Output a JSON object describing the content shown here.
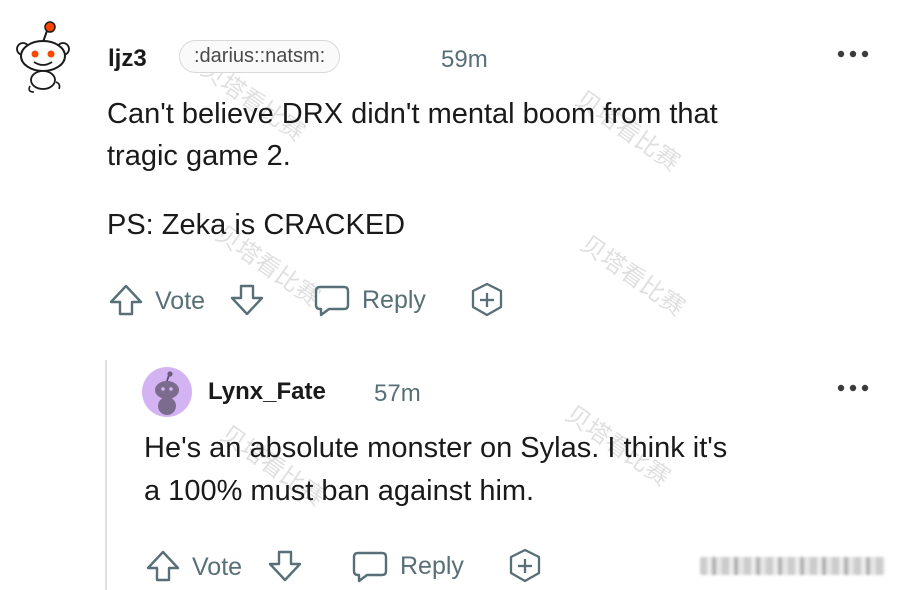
{
  "comment": {
    "username": "ljz3",
    "flair": ":darius::natsm:",
    "time": "59m",
    "body_line1": "Can't believe DRX didn't mental boom from that",
    "body_line2": "tragic game 2.",
    "body_line3": "PS: Zeka is CRACKED",
    "vote_label": "Vote",
    "reply_label": "Reply",
    "avatar_icon": "snoo-avatar-icon"
  },
  "reply": {
    "username": "Lynx_Fate",
    "time": "57m",
    "body_line1": "He's an absolute monster on Sylas. I think it's",
    "body_line2": "a 100% must ban against him.",
    "vote_label": "Vote",
    "reply_label": "Reply",
    "avatar_icon": "snoo-avatar-icon"
  },
  "watermark_text": "贝塔看比赛",
  "colors": {
    "accent_red": "#ff4500",
    "avatar_purple": "#d4b3f2",
    "text_muted": "#576f76"
  }
}
